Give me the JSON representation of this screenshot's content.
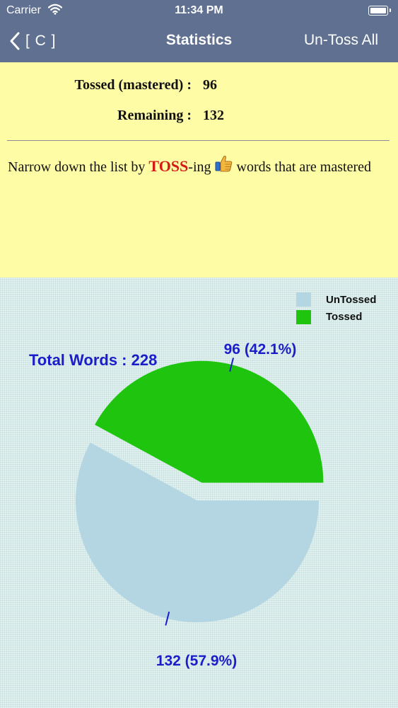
{
  "status_bar": {
    "carrier": "Carrier",
    "time": "11:34 PM"
  },
  "nav": {
    "back_label": "[ C ]",
    "title": "Statistics",
    "right_label": "Un-Toss All"
  },
  "stats": {
    "tossed_label": "Tossed (mastered) :",
    "tossed_value": "96",
    "remaining_label": "Remaining :",
    "remaining_value": "132"
  },
  "description": {
    "before": "Narrow down the list by ",
    "highlight": "TOSS",
    "after_highlight": "-ing",
    "after_icon": " words that are mastered",
    "icon": "thumbs-up-icon"
  },
  "colors": {
    "nav_bg": "#5f7091",
    "panel_bg": "#fffca6",
    "untossed": "#b3d6e2",
    "tossed": "#1ec40d",
    "chart_label": "#1b1ec8",
    "toss_highlight": "#d61a1a"
  },
  "chart_data": {
    "type": "pie",
    "title": "Total Words : 228",
    "legend": [
      "UnTossed",
      "Tossed"
    ],
    "legend_position": "top-right",
    "slices": [
      {
        "name": "UnTossed",
        "value": 132,
        "percent": 57.9,
        "label": "132 (57.9%)",
        "color": "#b3d6e2",
        "exploded": false
      },
      {
        "name": "Tossed",
        "value": 96,
        "percent": 42.1,
        "label": "96 (42.1%)",
        "color": "#1ec40d",
        "exploded": true
      }
    ]
  }
}
